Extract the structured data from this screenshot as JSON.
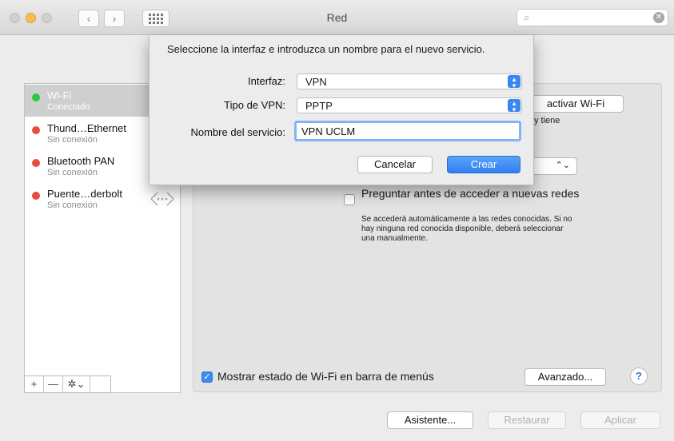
{
  "window": {
    "title": "Red",
    "search_placeholder": ""
  },
  "services": [
    {
      "name": "Wi-Fi",
      "status": "Conectado",
      "color": "#2bc840",
      "selected": true
    },
    {
      "name": "Thund…Ethernet",
      "status": "Sin conexión",
      "color": "#e94c3d",
      "selected": false
    },
    {
      "name": "Bluetooth PAN",
      "status": "Sin conexión",
      "color": "#e94c3d",
      "selected": false
    },
    {
      "name": "Puente…derbolt",
      "status": "Sin conexión",
      "color": "#e94c3d",
      "selected": false
    }
  ],
  "sidebar_toolbar": {
    "add": "+",
    "remove": "—",
    "gear": "✲⌄"
  },
  "panel": {
    "wifi_toggle_label": "activar Wi-Fi",
    "info_fragment": "y tiene",
    "ask_checkbox_label": "Preguntar antes de acceder a nuevas redes",
    "ask_checkbox_checked": false,
    "ask_description": "Se accederá automáticamente a las redes conocidas. Si no hay ninguna red conocida disponible, deberá seleccionar una manualmente.",
    "show_status_label": "Mostrar estado de Wi-Fi en barra de menús",
    "show_status_checked": true,
    "advanced_button": "Avanzado...",
    "help_button": "?"
  },
  "footer": {
    "assistant": "Asistente...",
    "revert": "Restaurar",
    "apply": "Aplicar"
  },
  "sheet": {
    "prompt": "Seleccione la interfaz e introduzca un nombre para el nuevo servicio.",
    "interface_label": "Interfaz:",
    "interface_value": "VPN",
    "vpn_type_label": "Tipo de VPN:",
    "vpn_type_value": "PPTP",
    "service_name_label": "Nombre del servicio:",
    "service_name_value": "VPN UCLM",
    "cancel": "Cancelar",
    "create": "Crear"
  },
  "colors": {
    "accent": "#3b8bf0",
    "connected": "#2bc840",
    "disconnected": "#e94c3d"
  }
}
